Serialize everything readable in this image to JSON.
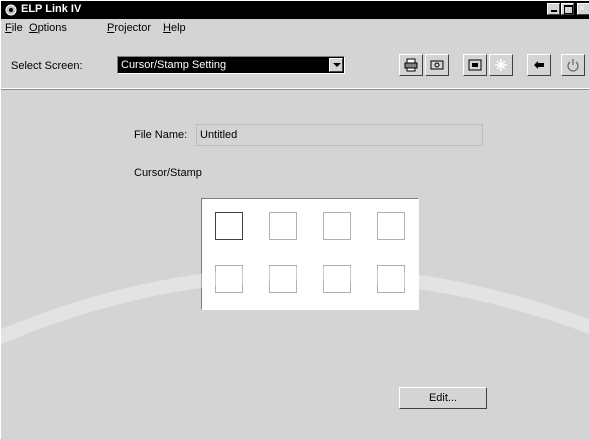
{
  "window": {
    "title": "ELP Link IV",
    "controls": [
      "minimize-icon",
      "maximize-icon",
      "close-icon"
    ]
  },
  "menubar": {
    "items": [
      {
        "label": "File",
        "mnemonic": "F"
      },
      {
        "label": "Options",
        "mnemonic": "O"
      },
      {
        "label": "Projector",
        "mnemonic": "P"
      },
      {
        "label": "Help",
        "mnemonic": "H"
      }
    ]
  },
  "toolbar": {
    "select_label": "Select Screen:",
    "select_value": "Cursor/Stamp Setting",
    "tools": [
      "printer-icon",
      "camera-icon",
      "screen-icon",
      "sparkle-icon",
      "pointer-icon",
      "power-icon"
    ]
  },
  "form": {
    "file_name_label": "File Name:",
    "file_name_value": "Untitled",
    "section_label": "Cursor/Stamp",
    "slots": [
      {
        "selected": true
      },
      {
        "selected": false
      },
      {
        "selected": false
      },
      {
        "selected": false
      },
      {
        "selected": false
      },
      {
        "selected": false
      },
      {
        "selected": false
      },
      {
        "selected": false
      }
    ],
    "edit_label": "Edit..."
  },
  "colors": {
    "titlebar": "#000000",
    "face": "#d4d4d4",
    "select_bg": "#000000"
  }
}
